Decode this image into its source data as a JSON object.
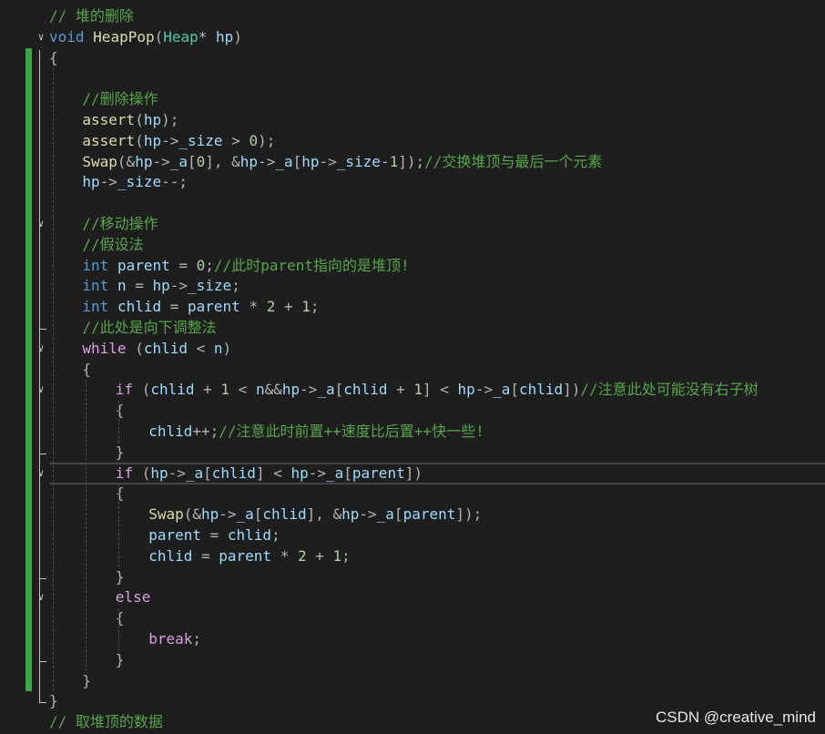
{
  "editor": {
    "colors": {
      "background": "#1e1e1e",
      "keyword": "#569cd6",
      "control": "#d8a0df",
      "function": "#dcdcaa",
      "type": "#4ec9b0",
      "identifier": "#9cdcfe",
      "comment": "#57a64a",
      "number": "#b5cea8",
      "change_bar": "#3fa548"
    },
    "fold_icon": "chevron-down-icon",
    "lines": [
      {
        "tokens": [
          {
            "t": "cm",
            "v": "// 堆的删除"
          }
        ]
      },
      {
        "tokens": [
          {
            "t": "kw",
            "v": "void"
          },
          {
            "t": "tx",
            "v": " "
          },
          {
            "t": "fn",
            "v": "HeapPop"
          },
          {
            "t": "pu",
            "v": "("
          },
          {
            "t": "ty",
            "v": "Heap"
          },
          {
            "t": "pu",
            "v": "* "
          },
          {
            "t": "id",
            "v": "hp"
          },
          {
            "t": "pu",
            "v": ")"
          }
        ]
      },
      {
        "tokens": [
          {
            "t": "pu",
            "v": "{"
          }
        ]
      },
      {
        "tokens": []
      },
      {
        "tokens": [
          {
            "t": "cm",
            "v": "//删除操作"
          }
        ]
      },
      {
        "tokens": [
          {
            "t": "fn",
            "v": "assert"
          },
          {
            "t": "pu",
            "v": "("
          },
          {
            "t": "id",
            "v": "hp"
          },
          {
            "t": "pu",
            "v": ");"
          }
        ]
      },
      {
        "tokens": [
          {
            "t": "fn",
            "v": "assert"
          },
          {
            "t": "pu",
            "v": "("
          },
          {
            "t": "id",
            "v": "hp"
          },
          {
            "t": "pu",
            "v": "->"
          },
          {
            "t": "id",
            "v": "_size"
          },
          {
            "t": "pu",
            "v": " > "
          },
          {
            "t": "num",
            "v": "0"
          },
          {
            "t": "pu",
            "v": ");"
          }
        ]
      },
      {
        "tokens": [
          {
            "t": "fn",
            "v": "Swap"
          },
          {
            "t": "pu",
            "v": "(&"
          },
          {
            "t": "id",
            "v": "hp"
          },
          {
            "t": "pu",
            "v": "->"
          },
          {
            "t": "id",
            "v": "_a"
          },
          {
            "t": "pu",
            "v": "["
          },
          {
            "t": "num",
            "v": "0"
          },
          {
            "t": "pu",
            "v": "], &"
          },
          {
            "t": "id",
            "v": "hp"
          },
          {
            "t": "pu",
            "v": "->"
          },
          {
            "t": "id",
            "v": "_a"
          },
          {
            "t": "pu",
            "v": "["
          },
          {
            "t": "id",
            "v": "hp"
          },
          {
            "t": "pu",
            "v": "->"
          },
          {
            "t": "id",
            "v": "_size"
          },
          {
            "t": "pu",
            "v": "-"
          },
          {
            "t": "num",
            "v": "1"
          },
          {
            "t": "pu",
            "v": "]);"
          },
          {
            "t": "cm",
            "v": "//交换堆顶与最后一个元素"
          }
        ]
      },
      {
        "tokens": [
          {
            "t": "id",
            "v": "hp"
          },
          {
            "t": "pu",
            "v": "->"
          },
          {
            "t": "id",
            "v": "_size"
          },
          {
            "t": "pu",
            "v": "--;"
          }
        ]
      },
      {
        "tokens": []
      },
      {
        "tokens": [
          {
            "t": "cm",
            "v": "//移动操作"
          }
        ]
      },
      {
        "tokens": [
          {
            "t": "cm",
            "v": "//假设法"
          }
        ]
      },
      {
        "tokens": [
          {
            "t": "kw",
            "v": "int"
          },
          {
            "t": "tx",
            "v": " "
          },
          {
            "t": "id",
            "v": "parent"
          },
          {
            "t": "pu",
            "v": " = "
          },
          {
            "t": "num",
            "v": "0"
          },
          {
            "t": "pu",
            "v": ";"
          },
          {
            "t": "cm",
            "v": "//此时parent指向的是堆顶!"
          }
        ]
      },
      {
        "tokens": [
          {
            "t": "kw",
            "v": "int"
          },
          {
            "t": "tx",
            "v": " "
          },
          {
            "t": "id",
            "v": "n"
          },
          {
            "t": "pu",
            "v": " = "
          },
          {
            "t": "id",
            "v": "hp"
          },
          {
            "t": "pu",
            "v": "->"
          },
          {
            "t": "id",
            "v": "_size"
          },
          {
            "t": "pu",
            "v": ";"
          }
        ]
      },
      {
        "tokens": [
          {
            "t": "kw",
            "v": "int"
          },
          {
            "t": "tx",
            "v": " "
          },
          {
            "t": "id",
            "v": "chlid"
          },
          {
            "t": "pu",
            "v": " = "
          },
          {
            "t": "id",
            "v": "parent"
          },
          {
            "t": "pu",
            "v": " * "
          },
          {
            "t": "num",
            "v": "2"
          },
          {
            "t": "pu",
            "v": " + "
          },
          {
            "t": "num",
            "v": "1"
          },
          {
            "t": "pu",
            "v": ";"
          }
        ]
      },
      {
        "tokens": [
          {
            "t": "cm",
            "v": "//此处是向下调整法"
          }
        ]
      },
      {
        "tokens": [
          {
            "t": "ctl",
            "v": "while"
          },
          {
            "t": "pu",
            "v": " ("
          },
          {
            "t": "id",
            "v": "chlid"
          },
          {
            "t": "pu",
            "v": " < "
          },
          {
            "t": "id",
            "v": "n"
          },
          {
            "t": "pu",
            "v": ")"
          }
        ]
      },
      {
        "tokens": [
          {
            "t": "pu",
            "v": "{"
          }
        ]
      },
      {
        "tokens": [
          {
            "t": "ctl",
            "v": "if"
          },
          {
            "t": "pu",
            "v": " ("
          },
          {
            "t": "id",
            "v": "chlid"
          },
          {
            "t": "pu",
            "v": " + "
          },
          {
            "t": "num",
            "v": "1"
          },
          {
            "t": "pu",
            "v": " < "
          },
          {
            "t": "id",
            "v": "n"
          },
          {
            "t": "pu",
            "v": "&&"
          },
          {
            "t": "id",
            "v": "hp"
          },
          {
            "t": "pu",
            "v": "->"
          },
          {
            "t": "id",
            "v": "_a"
          },
          {
            "t": "pu",
            "v": "["
          },
          {
            "t": "id",
            "v": "chlid"
          },
          {
            "t": "pu",
            "v": " + "
          },
          {
            "t": "num",
            "v": "1"
          },
          {
            "t": "pu",
            "v": "] < "
          },
          {
            "t": "id",
            "v": "hp"
          },
          {
            "t": "pu",
            "v": "->"
          },
          {
            "t": "id",
            "v": "_a"
          },
          {
            "t": "pu",
            "v": "["
          },
          {
            "t": "id",
            "v": "chlid"
          },
          {
            "t": "pu",
            "v": "])"
          },
          {
            "t": "cm",
            "v": "//注意此处可能没有右子树"
          }
        ]
      },
      {
        "tokens": [
          {
            "t": "pu",
            "v": "{"
          }
        ]
      },
      {
        "tokens": [
          {
            "t": "id",
            "v": "chlid"
          },
          {
            "t": "pu",
            "v": "++;"
          },
          {
            "t": "cm",
            "v": "//注意此时前置++速度比后置++快一些!"
          }
        ]
      },
      {
        "tokens": [
          {
            "t": "pu",
            "v": "}"
          }
        ]
      },
      {
        "tokens": [
          {
            "t": "ctl",
            "v": "if"
          },
          {
            "t": "pu",
            "v": " ("
          },
          {
            "t": "id",
            "v": "hp"
          },
          {
            "t": "pu",
            "v": "->"
          },
          {
            "t": "id",
            "v": "_a"
          },
          {
            "t": "pu",
            "v": "["
          },
          {
            "t": "id",
            "v": "chlid"
          },
          {
            "t": "pu",
            "v": "] < "
          },
          {
            "t": "id",
            "v": "hp"
          },
          {
            "t": "pu",
            "v": "->"
          },
          {
            "t": "id",
            "v": "_a"
          },
          {
            "t": "pu",
            "v": "["
          },
          {
            "t": "id",
            "v": "parent"
          },
          {
            "t": "pu",
            "v": "])"
          }
        ]
      },
      {
        "tokens": [
          {
            "t": "pu",
            "v": "{"
          }
        ]
      },
      {
        "tokens": [
          {
            "t": "fn",
            "v": "Swap"
          },
          {
            "t": "pu",
            "v": "(&"
          },
          {
            "t": "id",
            "v": "hp"
          },
          {
            "t": "pu",
            "v": "->"
          },
          {
            "t": "id",
            "v": "_a"
          },
          {
            "t": "pu",
            "v": "["
          },
          {
            "t": "id",
            "v": "chlid"
          },
          {
            "t": "pu",
            "v": "], &"
          },
          {
            "t": "id",
            "v": "hp"
          },
          {
            "t": "pu",
            "v": "->"
          },
          {
            "t": "id",
            "v": "_a"
          },
          {
            "t": "pu",
            "v": "["
          },
          {
            "t": "id",
            "v": "parent"
          },
          {
            "t": "pu",
            "v": "]);"
          }
        ]
      },
      {
        "tokens": [
          {
            "t": "id",
            "v": "parent"
          },
          {
            "t": "pu",
            "v": " = "
          },
          {
            "t": "id",
            "v": "chlid"
          },
          {
            "t": "pu",
            "v": ";"
          }
        ]
      },
      {
        "tokens": [
          {
            "t": "id",
            "v": "chlid"
          },
          {
            "t": "pu",
            "v": " = "
          },
          {
            "t": "id",
            "v": "parent"
          },
          {
            "t": "pu",
            "v": " * "
          },
          {
            "t": "num",
            "v": "2"
          },
          {
            "t": "pu",
            "v": " + "
          },
          {
            "t": "num",
            "v": "1"
          },
          {
            "t": "pu",
            "v": ";"
          }
        ]
      },
      {
        "tokens": [
          {
            "t": "pu",
            "v": "}"
          }
        ]
      },
      {
        "tokens": [
          {
            "t": "ctl",
            "v": "else"
          }
        ]
      },
      {
        "tokens": [
          {
            "t": "pu",
            "v": "{"
          }
        ]
      },
      {
        "tokens": [
          {
            "t": "ctl",
            "v": "break"
          },
          {
            "t": "pu",
            "v": ";"
          }
        ]
      },
      {
        "tokens": [
          {
            "t": "pu",
            "v": "}"
          }
        ]
      },
      {
        "tokens": [
          {
            "t": "pu",
            "v": "}"
          }
        ]
      },
      {
        "tokens": [
          {
            "t": "pu",
            "v": "}"
          }
        ]
      },
      {
        "tokens": [
          {
            "t": "cm",
            "v": "// 取堆顶的数据"
          }
        ]
      }
    ]
  },
  "watermark": {
    "text": "CSDN @creative_mind"
  }
}
